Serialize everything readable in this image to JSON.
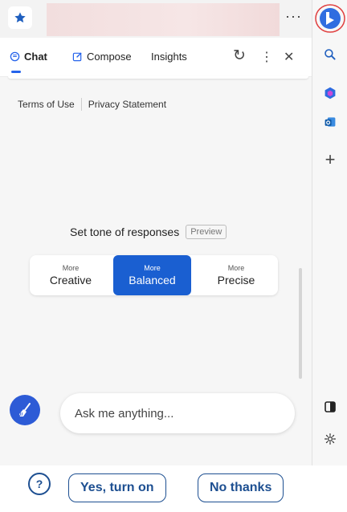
{
  "browser": {
    "favorite_icon": "star-icon",
    "more_label": "···",
    "colors": {
      "accent_blue": "#1a5fd1",
      "bing_highlight": "#e04040"
    }
  },
  "rail": {
    "icons": [
      "bing-copilot-icon",
      "search-icon",
      "office-icon",
      "outlook-icon",
      "add-icon",
      "split-screen-icon",
      "settings-icon"
    ],
    "add_label": "+"
  },
  "panel": {
    "tabs": [
      {
        "label": "Chat",
        "icon": "chat-icon"
      },
      {
        "label": "Compose",
        "icon": "compose-icon"
      },
      {
        "label": "Insights",
        "icon": ""
      }
    ],
    "tools": {
      "refresh": "↻",
      "more": "⋮",
      "close": "✕"
    }
  },
  "links": {
    "terms": "Terms of Use",
    "privacy": "Privacy Statement"
  },
  "tone": {
    "label": "Set tone of responses",
    "badge": "Preview",
    "options": [
      {
        "small": "More",
        "big": "Creative",
        "active": false
      },
      {
        "small": "More",
        "big": "Balanced",
        "active": true
      },
      {
        "small": "More",
        "big": "Precise",
        "active": false
      }
    ]
  },
  "input": {
    "placeholder": "Ask me anything..."
  },
  "prompt": {
    "help_glyph": "?",
    "yes_label": "Yes, turn on",
    "no_label": "No thanks"
  }
}
